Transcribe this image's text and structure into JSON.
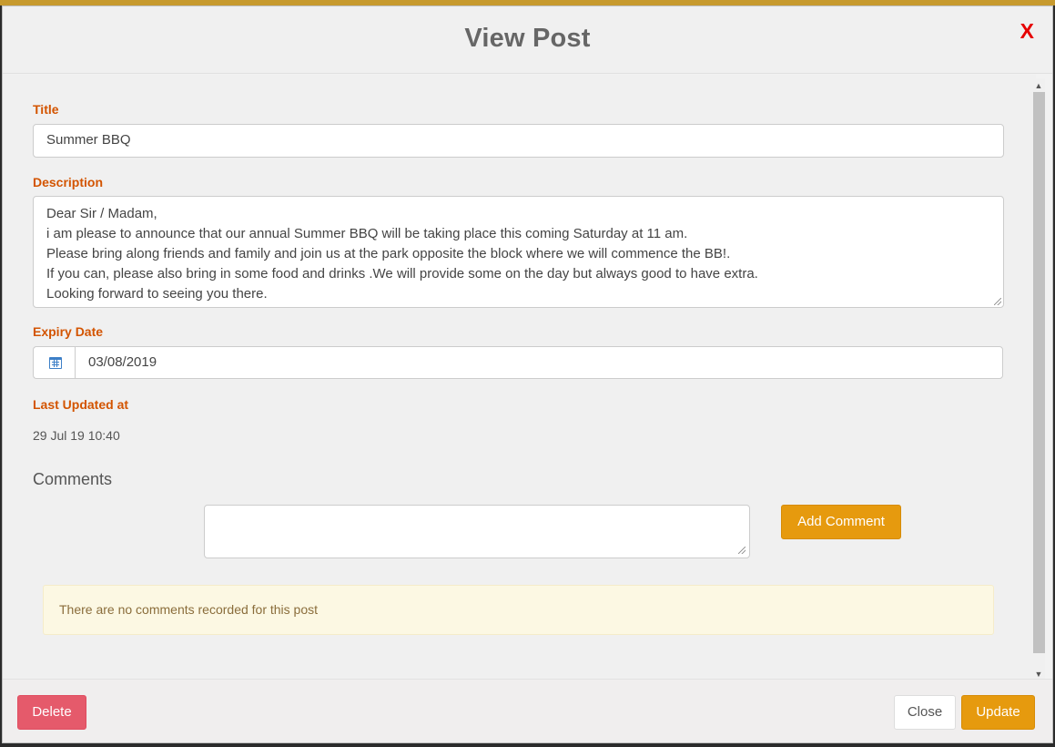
{
  "header": {
    "title": "View Post",
    "close_symbol": "X"
  },
  "form": {
    "title_label": "Title",
    "title_value": "Summer BBQ",
    "description_label": "Description",
    "description_lines": [
      "Dear Sir / Madam,",
      "i am please to announce that our annual Summer BBQ will be taking place this coming Saturday at 11 am.",
      "Please bring along friends and family and join us at the park opposite the block where we will commence the BB!.",
      "If you can, please also bring in some food and drinks .We will provide some on the day but always good to have extra.",
      "Looking forward to seeing you there."
    ],
    "expiry_label": "Expiry Date",
    "expiry_value": "03/08/2019",
    "last_updated_label": "Last Updated at",
    "last_updated_value": "29 Jul 19 10:40"
  },
  "comments": {
    "heading": "Comments",
    "input_value": "",
    "add_button": "Add Comment",
    "empty_message": "There are no comments recorded for this post"
  },
  "footer": {
    "delete_button": "Delete",
    "close_button": "Close",
    "update_button": "Update"
  },
  "colors": {
    "label": "#d35400",
    "warning_button": "#e69a0e",
    "danger_button": "#e55a6b",
    "close_x": "#e60000"
  }
}
